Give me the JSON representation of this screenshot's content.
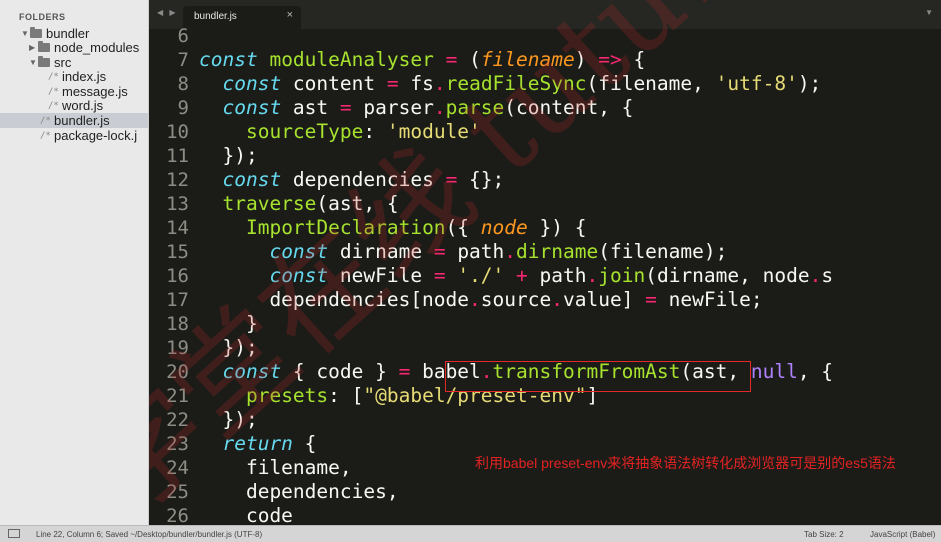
{
  "sidebar": {
    "title": "FOLDERS",
    "items": [
      {
        "label": "bundler",
        "type": "folder",
        "open": true
      },
      {
        "label": "node_modules",
        "type": "folder",
        "open": false
      },
      {
        "label": "src",
        "type": "folder",
        "open": true
      },
      {
        "label": "index.js",
        "type": "file"
      },
      {
        "label": "message.js",
        "type": "file"
      },
      {
        "label": "word.js",
        "type": "file"
      },
      {
        "label": "bundler.js",
        "type": "file",
        "selected": true
      },
      {
        "label": "package-lock.j",
        "type": "file"
      }
    ]
  },
  "tabs": [
    {
      "label": "bundler.js",
      "close": "×"
    }
  ],
  "tab_nav": "◀ ▶",
  "tab_menu": "▼",
  "line_numbers": [
    "6",
    "7",
    "8",
    "9",
    "10",
    "11",
    "12",
    "13",
    "14",
    "15",
    "16",
    "17",
    "18",
    "19",
    "20",
    "21",
    "22",
    "23",
    "24",
    "25",
    "26"
  ],
  "code_lines": [
    "",
    "const moduleAnalyser = (filename) => {",
    "  const content = fs.readFileSync(filename, 'utf-8');",
    "  const ast = parser.parse(content, {",
    "    sourceType: 'module'",
    "  });",
    "  const dependencies = {};",
    "  traverse(ast, {",
    "    ImportDeclaration({ node }) {",
    "      const dirname = path.dirname(filename);",
    "      const newFile = './' + path.join(dirname, node.s",
    "      dependencies[node.source.value] = newFile;",
    "    }",
    "  });",
    "  const { code } = babel.transformFromAst(ast, null, {",
    "    presets: [\"@babel/preset-env\"]",
    "  });",
    "  return {",
    "    filename,",
    "    dependencies,",
    "    code"
  ],
  "annotation": "利用babel preset-env来将抽象语法树转化成浏览器可是别的es5语法",
  "watermark": "学堂在线 tutu123.com",
  "statusbar": {
    "left": "Line 22, Column 6; Saved ~/Desktop/bundler/bundler.js (UTF-8)",
    "tab_size": "Tab Size: 2",
    "language": "JavaScript (Babel)"
  },
  "colors": {
    "editor_bg": "#1b1c18",
    "keyword": "#66d9ef",
    "function": "#a6e22e",
    "string": "#e6db74",
    "operator": "#f92672",
    "argument": "#fd971f",
    "constant": "#ae81ff",
    "annotation": "#e32222"
  }
}
